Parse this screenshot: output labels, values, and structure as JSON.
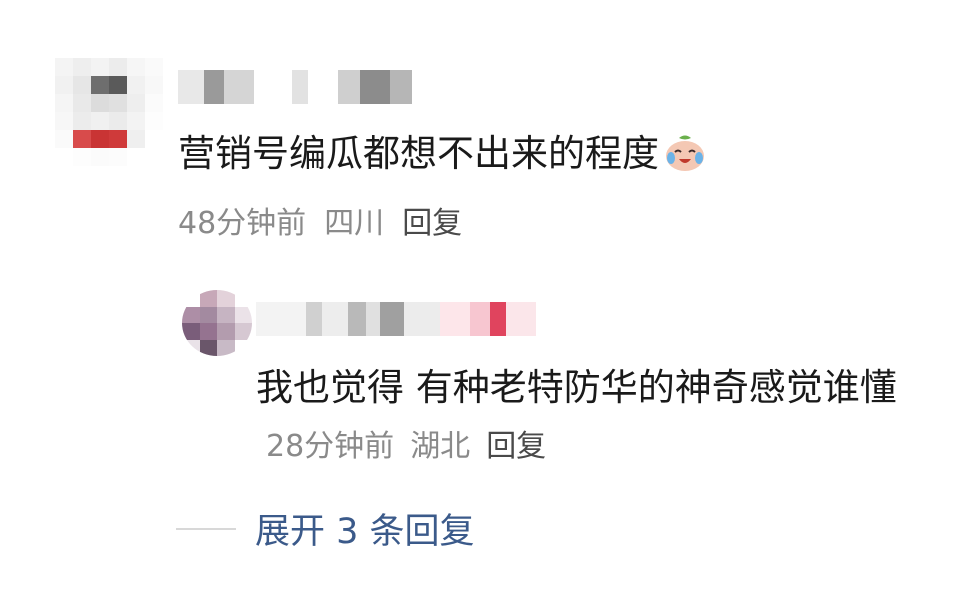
{
  "comment": {
    "text": "营销号编瓜都想不出来的程度",
    "emoji": "crying-laughing-face-icon",
    "time": "48分钟前",
    "location": "四川",
    "reply_label": "回复"
  },
  "reply": {
    "text": "我也觉得 有种老特防华的神奇感觉谁懂",
    "time": "28分钟前",
    "location": "湖北",
    "reply_label": "回复"
  },
  "expand": {
    "label": "展开 3 条回复"
  },
  "colors": {
    "text": "#1a1a1a",
    "meta": "#8a8a8a",
    "link": "#3b5a8a"
  }
}
